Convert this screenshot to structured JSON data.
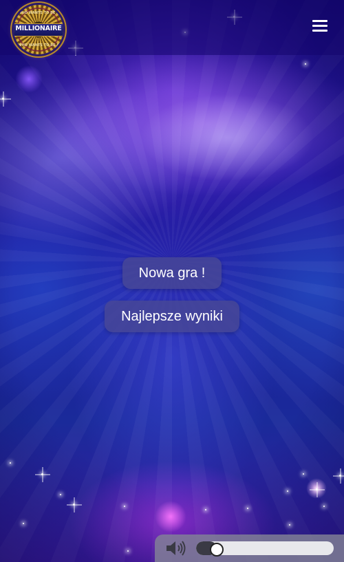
{
  "app": {
    "logo": {
      "text": "MILLIONAIRE",
      "arc_top": "WHO WANTS TO BE A",
      "arc_bottom": "WHO WANTS TO BE A"
    },
    "menu_icon": "hamburger-menu-icon"
  },
  "main_menu": {
    "new_game_label": "Nowa gra !",
    "high_scores_label": "Najlepsze wyniki"
  },
  "volume": {
    "icon": "speaker-icon",
    "level": 0.1
  },
  "colors": {
    "button_bg": "#464696",
    "header_bg": "#14056e",
    "volume_bar_bg": "#828296",
    "background": "#1a0a8a"
  }
}
